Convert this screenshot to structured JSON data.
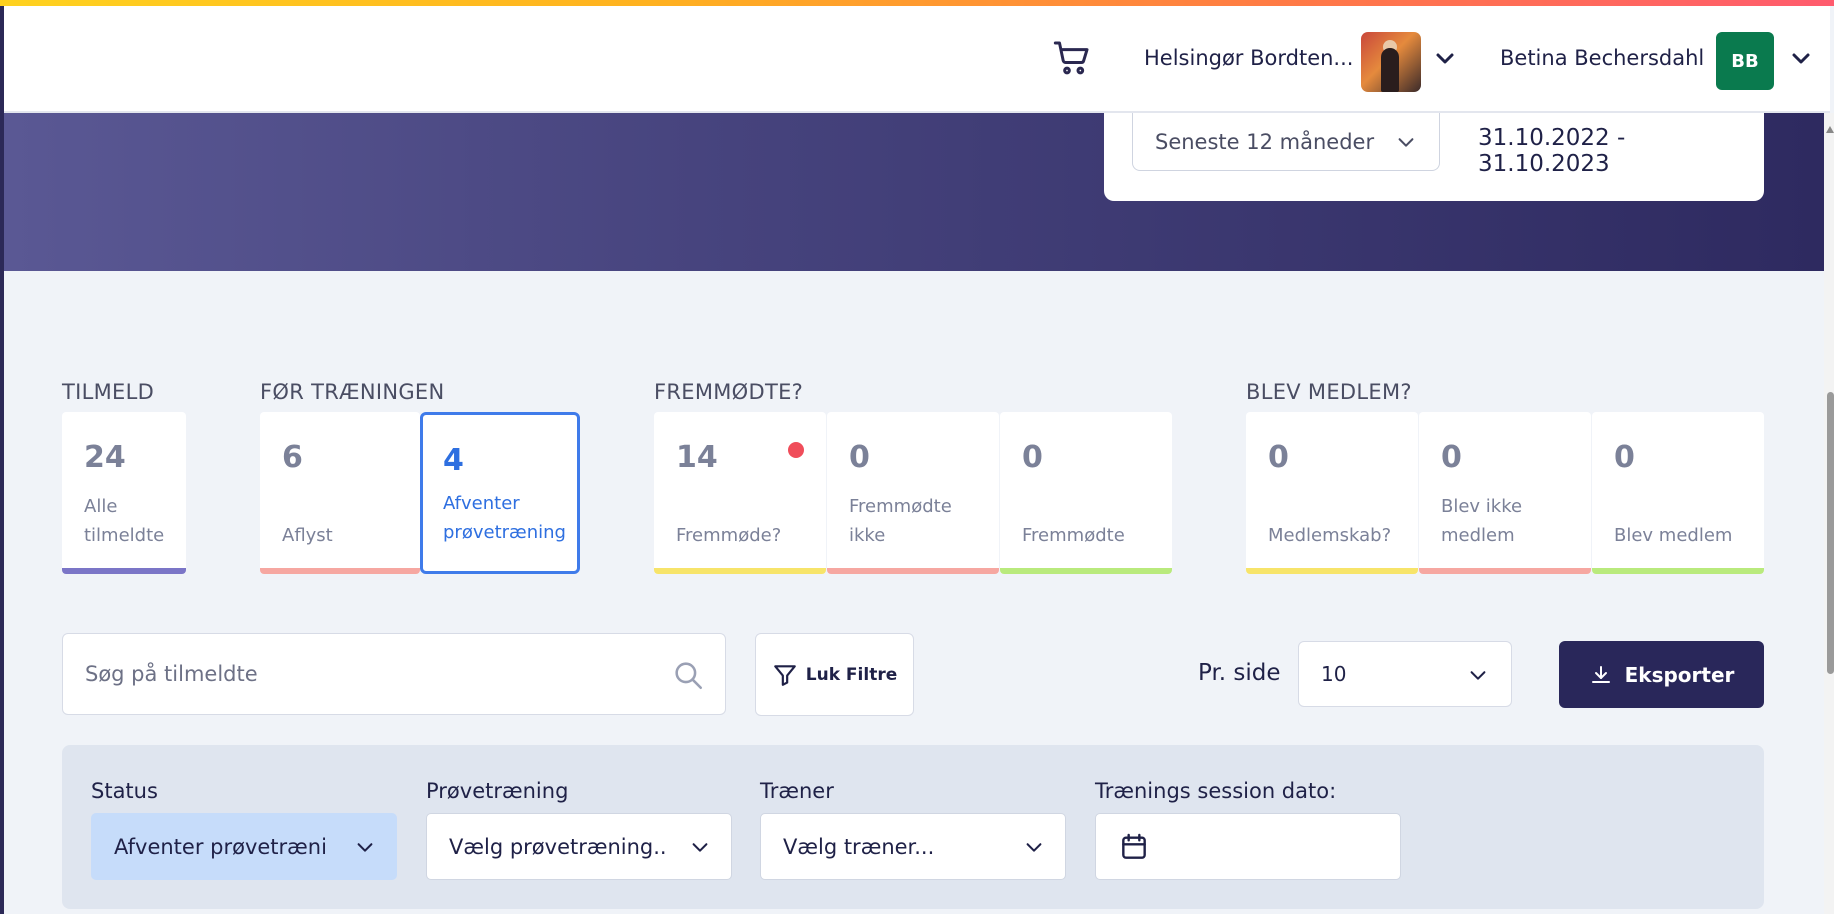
{
  "header": {
    "club_name": "Helsingør Bordten...",
    "user_name": "Betina Bechersdahl",
    "user_initials": "BB",
    "user_badge_color": "#0a7a4e"
  },
  "date_filter": {
    "period": "Seneste 12 måneder",
    "range": "31.10.2022 - 31.10.2023"
  },
  "groups": {
    "tilmeld": "TILMELD",
    "foer": "FØR TRÆNINGEN",
    "fremmoedte": "FREMMØDTE?",
    "medlem": "BLEV MEDLEM?"
  },
  "stats": [
    {
      "value": "24",
      "label": "Alle tilmeldte",
      "bar": "#7b75c7"
    },
    {
      "value": "6",
      "label": "Aflyst",
      "bar": "#f6a7a1"
    },
    {
      "value": "4",
      "label": "Afventer prøvetræning",
      "bar": "#3f7bea",
      "active": true
    },
    {
      "value": "14",
      "label": "Fremmøde?",
      "bar": "#f7e46a"
    },
    {
      "value": "0",
      "label": "Fremmødte ikke",
      "bar": "#f6a7a1"
    },
    {
      "value": "0",
      "label": "Fremmødte",
      "bar": "#b9ea7d"
    },
    {
      "value": "0",
      "label": "Medlemskab?",
      "bar": "#f7e46a"
    },
    {
      "value": "0",
      "label": "Blev ikke medlem",
      "bar": "#f6a7a1"
    },
    {
      "value": "0",
      "label": "Blev medlem",
      "bar": "#b9ea7d"
    }
  ],
  "toolbar": {
    "search_placeholder": "Søg på tilmeldte",
    "filter_label": "Luk Filtre",
    "per_page_label": "Pr. side",
    "per_page_value": "10",
    "export_label": "Eksporter"
  },
  "filters": {
    "status_label": "Status",
    "status_value": "Afventer prøvetræni",
    "trial_label": "Prøvetræning",
    "trial_value": "Vælg prøvetræning..",
    "trainer_label": "Træner",
    "trainer_value": "Vælg træner...",
    "date_label": "Trænings session dato:"
  }
}
